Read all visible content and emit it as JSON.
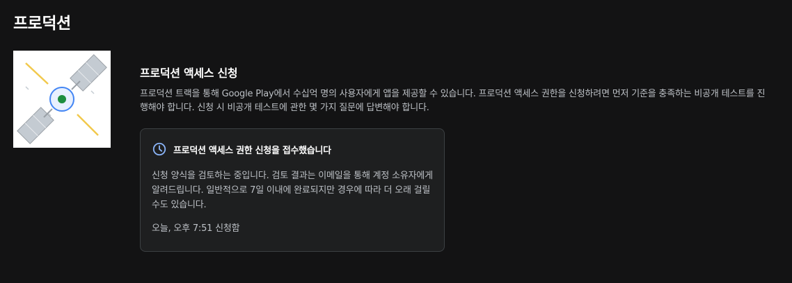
{
  "page": {
    "title": "프로덕션"
  },
  "illustration": {
    "icon": "satellite-illustration",
    "colors": {
      "background": "#ffffff",
      "panel": "#c4cbd2",
      "beam": "#f2c94c",
      "ring": "#4285f4",
      "core": "#1e8e3e"
    }
  },
  "access": {
    "title": "프로덕션 액세스 신청",
    "description": "프로덕션 트랙을 통해 Google Play에서 수십억 명의 사용자에게 앱을 제공할 수 있습니다. 프로덕션 액세스 권한을 신청하려면 먼저 기준을 충족하는 비공개 테스트를 진행해야 합니다. 신청 시 비공개 테스트에 관한 몇 가지 질문에 답변해야 합니다."
  },
  "status_card": {
    "icon": "clock-icon",
    "title": "프로덕션 액세스 권한 신청을 접수했습니다",
    "body": "신청 양식을 검토하는 중입니다. 검토 결과는 이메일을 통해 계정 소유자에게 알려드립니다. 일반적으로 7일 이내에 완료되지만 경우에 따라 더 오래 걸릴 수도 있습니다.",
    "timestamp": "오늘, 오후 7:51 신청함",
    "accent_color": "#8ab4f8"
  }
}
